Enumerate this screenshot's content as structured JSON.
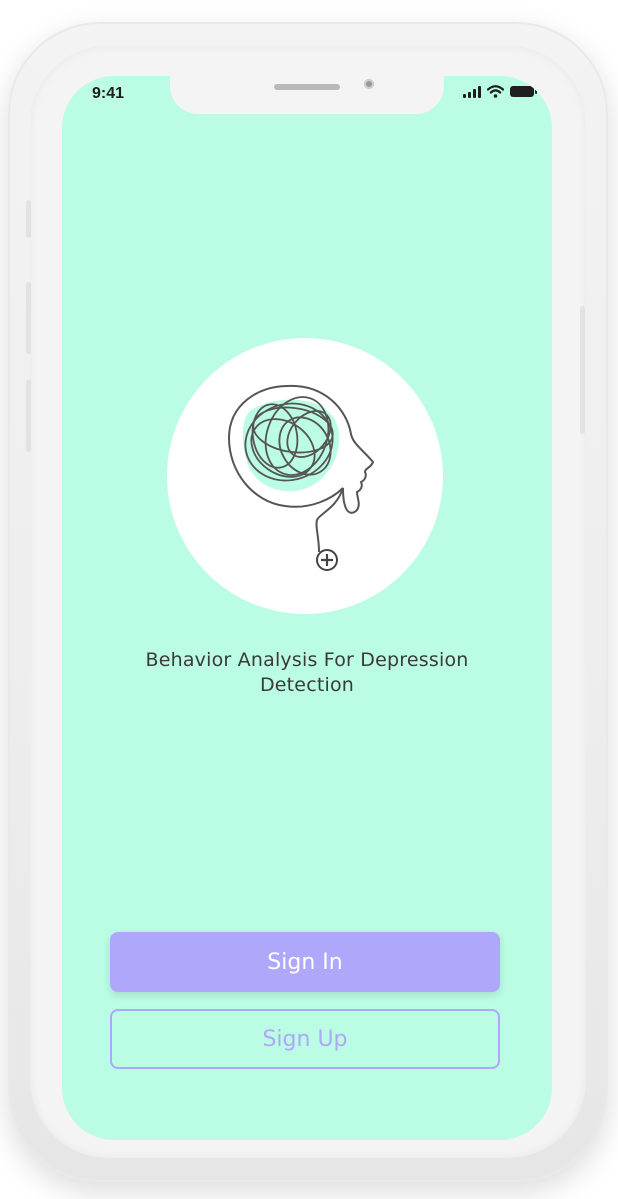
{
  "status_bar": {
    "time": "9:41"
  },
  "app": {
    "title": "Behavior Analysis For Depression Detection",
    "logo_icon": "tangled-mind-head-icon"
  },
  "actions": {
    "sign_in_label": "Sign In",
    "sign_up_label": "Sign Up"
  },
  "colors": {
    "screen_background": "#bbfce4",
    "accent": "#aea7fa",
    "text": "#3a3a3a"
  }
}
